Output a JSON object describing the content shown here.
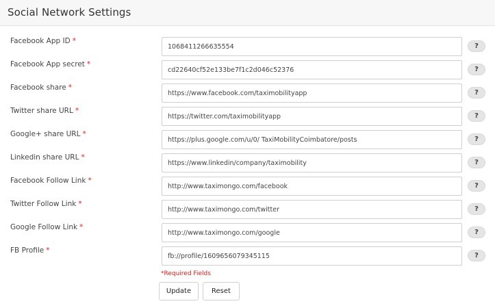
{
  "header": {
    "title": "Social Network Settings"
  },
  "fields": [
    {
      "label": "Facebook App ID",
      "value": "1068411266635554"
    },
    {
      "label": "Facebook App secret",
      "value": "cd22640cf52e133be7f1c2d046c52376"
    },
    {
      "label": "Facebook share",
      "value": "https://www.facebook.com/taximobilityapp"
    },
    {
      "label": "Twitter share URL",
      "value": "https://twitter.com/taximobilityapp"
    },
    {
      "label": "Google+ share URL",
      "value": "https://plus.google.com/u/0/ TaxiMobilityCoimbatore/posts"
    },
    {
      "label": "Linkedin share URL",
      "value": "https://www.linkedin/company/taximobility"
    },
    {
      "label": "Facebook Follow Link",
      "value": "http://www.taximongo.com/facebook"
    },
    {
      "label": "Twitter Follow Link",
      "value": "http://www.taximongo.com/twitter"
    },
    {
      "label": "Google Follow Link",
      "value": "http://www.taximongo.com/google"
    },
    {
      "label": "FB Profile",
      "value": "fb://profile/1609656079345115"
    }
  ],
  "required_marker": "*",
  "help_label": "?",
  "required_note": "*Required Fields",
  "buttons": {
    "update": "Update",
    "reset": "Reset"
  }
}
